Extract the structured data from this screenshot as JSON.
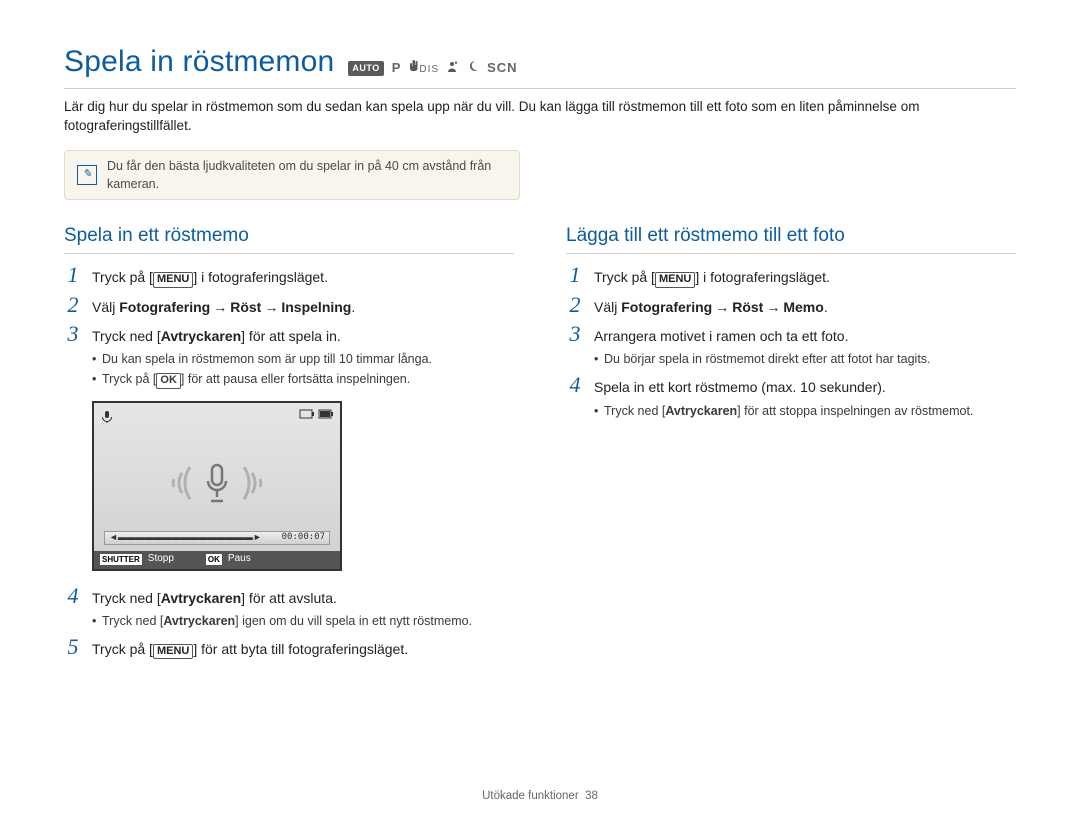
{
  "title": "Spela in röstmemon",
  "mode_icons": {
    "auto": "AUTO",
    "p": "P",
    "dis": "DIS",
    "night_icon": "moon-icon",
    "scn": "SCN"
  },
  "intro": "Lär dig hur du spelar in röstmemon som du sedan kan spela upp när du vill. Du kan lägga till röstmemon till ett foto som en liten påminnelse om fotograferingstillfället.",
  "tip": "Du får den bästa ljudkvaliteten om du spelar in på 40 cm avstånd från kameran.",
  "left": {
    "heading": "Spela in ett röstmemo",
    "steps": {
      "s1a": "Tryck på [",
      "s1_key": "MENU",
      "s1b": "] i fotograferingsläget.",
      "s2a": "Välj ",
      "s2b1": "Fotografering",
      "s2arrow": "→",
      "s2b2": "Röst",
      "s2b3": "Inspelning",
      "s2dot": ".",
      "s3a": "Tryck ned [",
      "s3_key": "Avtryckaren",
      "s3b": "] för att spela in.",
      "s3_sub1": "Du kan spela in röstmemon som är upp till 10 timmar långa.",
      "s3_sub2a": "Tryck på [",
      "s3_sub2_key": "OK",
      "s3_sub2b": "] för att pausa eller fortsätta inspelningen.",
      "s4a": "Tryck ned [",
      "s4_key": "Avtryckaren",
      "s4b": "] för att avsluta.",
      "s4_sub1a": "Tryck ned [",
      "s4_sub1_key": "Avtryckaren",
      "s4_sub1b": "] igen om du vill spela in ett nytt röstmemo.",
      "s5a": "Tryck på [",
      "s5_key": "MENU",
      "s5b": "] för att byta till fotograferingsläget."
    },
    "step_nums": {
      "n1": "1",
      "n2": "2",
      "n3": "3",
      "n4": "4",
      "n5": "5"
    }
  },
  "right": {
    "heading": "Lägga till ett röstmemo till ett foto",
    "steps": {
      "s1a": "Tryck på [",
      "s1_key": "MENU",
      "s1b": "] i fotograferingsläget.",
      "s2a": "Välj ",
      "s2b1": "Fotografering",
      "s2arrow": "→",
      "s2b2": "Röst",
      "s2b3": "Memo",
      "s2dot": ".",
      "s3": "Arrangera motivet i ramen och ta ett foto.",
      "s3_sub": "Du börjar spela in röstmemot direkt efter att fotot har tagits.",
      "s4": "Spela in ett kort röstmemo (max. 10 sekunder).",
      "s4_sub_a": "Tryck ned [",
      "s4_sub_key": "Avtryckaren",
      "s4_sub_b": "] för att stoppa inspelningen av röstmemot."
    },
    "step_nums": {
      "n1": "1",
      "n2": "2",
      "n3": "3",
      "n4": "4"
    }
  },
  "lcd": {
    "timer": "00:00:07",
    "shutter_tag": "SHUTTER",
    "stop": "Stopp",
    "ok_tag": "OK",
    "pause": "Paus"
  },
  "footer": {
    "section": "Utökade funktioner",
    "page": "38"
  }
}
